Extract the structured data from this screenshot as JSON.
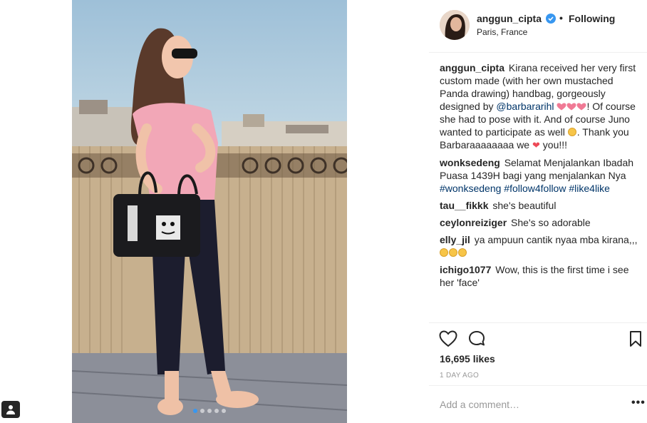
{
  "post": {
    "image_alt": "",
    "carousel_count": 5,
    "carousel_active": 0
  },
  "header": {
    "username": "anggun_cipta",
    "separator": "•",
    "follow_label": "Following",
    "location": "Paris, France"
  },
  "comments": [
    {
      "user": "anggun_cipta",
      "segments": [
        {
          "t": "text",
          "v": "Kirana received her very first custom made (with her own mustached Panda drawing) handbag, gorgeously designed by "
        },
        {
          "t": "link",
          "v": "@barbararihl"
        },
        {
          "t": "text",
          "v": " "
        },
        {
          "t": "emoji",
          "v": "sparkling-heart"
        },
        {
          "t": "emoji",
          "v": "sparkling-heart"
        },
        {
          "t": "emoji",
          "v": "sparkling-heart"
        },
        {
          "t": "text",
          "v": "! Of course she had to pose with it. And of course Juno wanted to participate as well "
        },
        {
          "t": "emoji",
          "v": "grinning-face"
        },
        {
          "t": "text",
          "v": ". Thank you Barbaraaaaaaaa we "
        },
        {
          "t": "emoji",
          "v": "red-heart"
        },
        {
          "t": "text",
          "v": " you!!!"
        }
      ]
    },
    {
      "user": "wonksedeng",
      "segments": [
        {
          "t": "text",
          "v": "Selamat Menjalankan Ibadah Puasa 1439H bagi yang menjalankan Nya "
        },
        {
          "t": "link",
          "v": "#wonksedeng"
        },
        {
          "t": "text",
          "v": " "
        },
        {
          "t": "link",
          "v": "#follow4follow"
        },
        {
          "t": "text",
          "v": " "
        },
        {
          "t": "link",
          "v": "#like4like"
        }
      ]
    },
    {
      "user": "tau__fikkk",
      "segments": [
        {
          "t": "text",
          "v": "she's beautiful"
        }
      ]
    },
    {
      "user": "ceylonreiziger",
      "segments": [
        {
          "t": "text",
          "v": "She's so adorable"
        }
      ]
    },
    {
      "user": "elly_jil",
      "segments": [
        {
          "t": "text",
          "v": "ya ampuun cantik nyaa mba kirana,,, "
        },
        {
          "t": "emoji",
          "v": "heart-eyes"
        },
        {
          "t": "emoji",
          "v": "heart-eyes"
        },
        {
          "t": "emoji",
          "v": "heart-eyes"
        }
      ]
    },
    {
      "user": "ichigo1077",
      "segments": [
        {
          "t": "text",
          "v": "Wow, this is the first time i see her 'face'"
        }
      ]
    },
    {
      "user": "",
      "segments": [
        {
          "t": "text",
          "v": ""
        }
      ]
    }
  ],
  "actions": {
    "like_icon": "heart-outline-icon",
    "comment_icon": "speech-bubble-icon",
    "save_icon": "bookmark-icon"
  },
  "likes": "16,695 likes",
  "time": "1 DAY AGO",
  "add_comment": {
    "placeholder": "Add a comment…",
    "more_label": "•••"
  },
  "colors": {
    "link": "#003569",
    "verified": "#3897f0",
    "muted": "#999999",
    "text": "#262626",
    "heart": "#ed4956"
  }
}
